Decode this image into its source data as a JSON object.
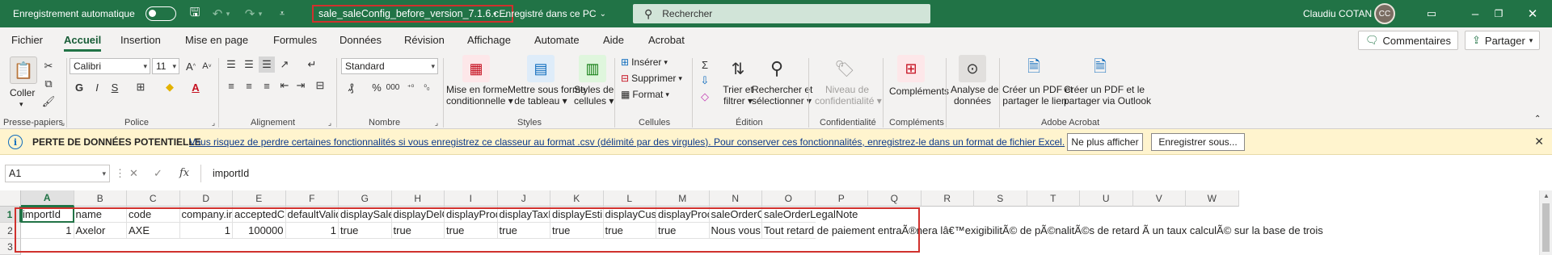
{
  "titlebar": {
    "autosave_label": "Enregistrement automatique",
    "filename": "sale_saleConfig_before_version_7.1.6.c...",
    "save_status": "• Enregistré dans ce PC",
    "search_placeholder": "Rechercher",
    "user_name": "Claudiu COTAN"
  },
  "menu": {
    "tabs": [
      "Fichier",
      "Accueil",
      "Insertion",
      "Mise en page",
      "Formules",
      "Données",
      "Révision",
      "Affichage",
      "Automate",
      "Aide",
      "Acrobat"
    ],
    "active_tab": "Accueil",
    "comments_label": "Commentaires",
    "share_label": "Partager"
  },
  "ribbon": {
    "paste_label": "Coller",
    "font_name": "Calibri",
    "font_size": "11",
    "number_format": "Standard",
    "bold": "G",
    "italic": "I",
    "underline": "S",
    "groups": [
      "Presse-papiers",
      "Police",
      "Alignement",
      "Nombre",
      "Styles",
      "Cellules",
      "Édition",
      "Confidentialité",
      "Compléments",
      "Adobe Acrobat"
    ],
    "styles": {
      "conditional": [
        "Mise en forme",
        "conditionnelle"
      ],
      "as_table": [
        "Mettre sous forme",
        "de tableau"
      ],
      "cell_styles": [
        "Styles de",
        "cellules"
      ]
    },
    "cells": {
      "insert": "Insérer",
      "delete": "Supprimer",
      "format": "Format"
    },
    "editing": {
      "sort": [
        "Trier et",
        "filtrer"
      ],
      "find": [
        "Rechercher et",
        "sélectionner"
      ]
    },
    "sensitivity": [
      "Niveau de",
      "confidentialité"
    ],
    "addins": "Compléments",
    "analyze": [
      "Analyse de",
      "données"
    ],
    "acrobat1": [
      "Créer un PDF et",
      "partager le lien"
    ],
    "acrobat2": [
      "Créer un PDF et le",
      "partager via Outlook"
    ]
  },
  "infobar": {
    "title": "PERTE DE DONNÉES POTENTIELLE",
    "message": "Vous risquez de perdre certaines fonctionnalités si vous enregistrez ce classeur au format .csv (délimité par des virgules). Pour conserver ces fonctionnalités, enregistrez-le dans un format de fichier Excel.",
    "dismiss_label": "Ne plus afficher",
    "save_as_label": "Enregistrer sous..."
  },
  "formulabar": {
    "cell_ref": "A1",
    "fx": "fx",
    "content": "importId"
  },
  "sheet": {
    "columns": [
      "A",
      "B",
      "C",
      "D",
      "E",
      "F",
      "G",
      "H",
      "I",
      "J",
      "K",
      "L",
      "M",
      "N",
      "O",
      "P",
      "Q",
      "R",
      "S",
      "T",
      "U",
      "V",
      "W"
    ],
    "row_numbers": [
      "1",
      "2",
      "3"
    ],
    "row1": [
      "importId",
      "name",
      "code",
      "company.im",
      "acceptedCre",
      "defaultValid",
      "displaySalen",
      "displayDelCo",
      "displayProdu",
      "displayTaxDe",
      "displayEstim",
      "displayCusto",
      "displayProdu",
      "saleOrderCli",
      "saleOrderLegalNote"
    ],
    "row2": [
      "1",
      "Axelor",
      "AXE",
      "1",
      "100000",
      "1",
      "true",
      "true",
      "true",
      "true",
      "true",
      "true",
      "true",
      "Nous vous so",
      "Tout retard de paiement entraÃ®nera lâ€™exigibilitÃ© de pÃ©nalitÃ©s de retard Ã  un taux calculÃ© sur la base de trois"
    ]
  },
  "colors": {
    "excel_green": "#217346",
    "highlight_red": "#d0312d",
    "info_bg": "#fff4ce"
  }
}
